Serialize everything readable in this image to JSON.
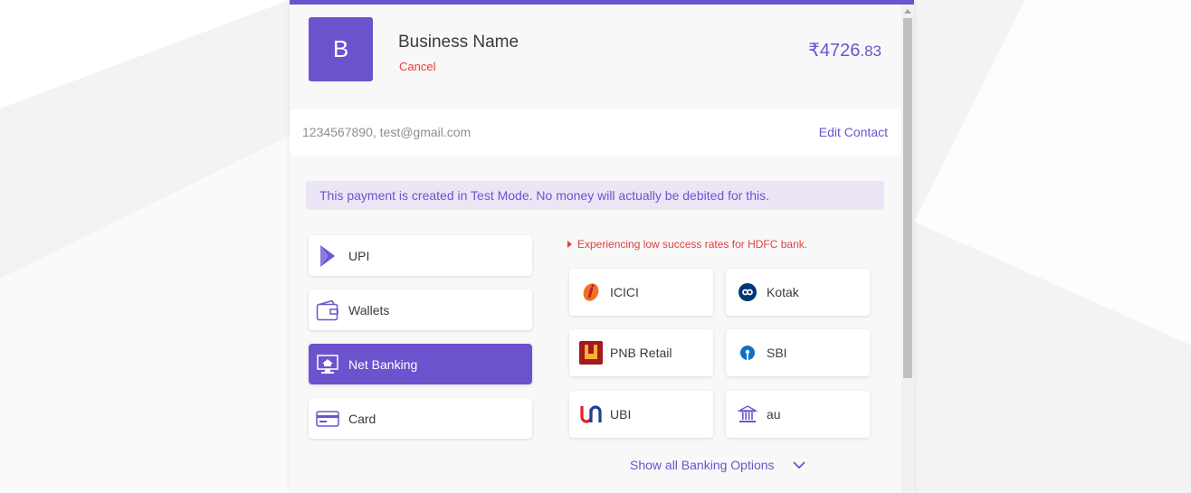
{
  "merchant": {
    "logo_letter": "B",
    "name": "Business Name",
    "cancel_label": "Cancel",
    "amount_main": "₹4726",
    "amount_decimal": ".83"
  },
  "contact": {
    "text": "1234567890, test@gmail.com",
    "edit_label": "Edit Contact"
  },
  "test_banner": "This payment is created in Test Mode. No money will actually be debited for this.",
  "methods": [
    {
      "label": "UPI",
      "icon": "upi-icon"
    },
    {
      "label": "Wallets",
      "icon": "wallet-icon"
    },
    {
      "label": "Net Banking",
      "icon": "netbanking-icon",
      "active": true
    },
    {
      "label": "Card",
      "icon": "card-icon"
    }
  ],
  "warning": "Experiencing low success rates for HDFC bank.",
  "banks": [
    {
      "label": "ICICI",
      "icon": "icici-icon"
    },
    {
      "label": "Kotak",
      "icon": "kotak-icon"
    },
    {
      "label": "PNB Retail",
      "icon": "pnb-icon"
    },
    {
      "label": "SBI",
      "icon": "sbi-icon"
    },
    {
      "label": "UBI",
      "icon": "ubi-icon"
    },
    {
      "label": "au",
      "icon": "bank-building-icon"
    }
  ],
  "show_all_label": "Show all Banking Options",
  "colors": {
    "accent": "#6c53cd",
    "error": "#e0403f",
    "banner_bg": "#ece5f5"
  }
}
